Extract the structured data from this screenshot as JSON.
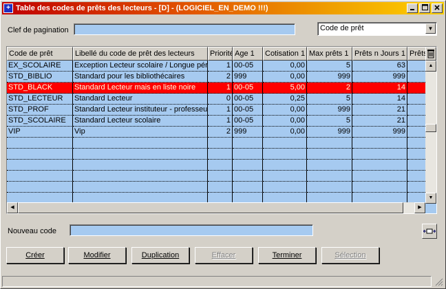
{
  "window": {
    "title": "Table des codes de prêts des lecteurs - [D] - (LOGICIEL_EN_DEMO !!!)"
  },
  "icons": {
    "app": "app-icon",
    "minimize": "minimize-icon",
    "maximize": "maximize-icon",
    "close": "close-icon"
  },
  "pagination": {
    "label": "Clef de pagination",
    "value": "",
    "sort_select": "Code de prêt"
  },
  "table": {
    "columns": [
      "Code de prêt",
      "Libellé du code de prêt des lecteurs",
      "Priorité",
      "Age 1",
      "Cotisation 1",
      "Max prêts 1",
      "Prêts n Jours 1",
      "PrêtsT"
    ],
    "rows": [
      [
        "EX_SCOLAIRE",
        "Exception Lecteur scolaire / Longue pér",
        "1",
        "00-05",
        "0,00",
        "5",
        "63"
      ],
      [
        "STD_BIBLIO",
        "Standard pour les bibliothécaires",
        "2",
        "999",
        "0,00",
        "999",
        "999"
      ],
      [
        "STD_BLACK",
        "Standard Lecteur mais en liste noire",
        "1",
        "00-05",
        "5,00",
        "2",
        "14"
      ],
      [
        "STD_LECTEUR",
        "Standard Lecteur",
        "0",
        "00-05",
        "0,25",
        "5",
        "14"
      ],
      [
        "STD_PROF",
        "Standard Lecteur instituteur - professeur",
        "1",
        "00-05",
        "0,00",
        "999",
        "21"
      ],
      [
        "STD_SCOLAIRE",
        "Standard Lecteur scolaire",
        "1",
        "00-05",
        "0,00",
        "5",
        "21"
      ],
      [
        "VIP",
        "Vip",
        "2",
        "999",
        "0,00",
        "999",
        "999"
      ]
    ],
    "selected_row": 2,
    "empty_rows": 6
  },
  "new_code": {
    "label": "Nouveau code",
    "value": ""
  },
  "buttons": {
    "create": "Créer",
    "modify": "Modifier",
    "duplicate": "Duplication",
    "delete": "Effacer",
    "finish": "Terminer",
    "select": "Sélection"
  },
  "colors": {
    "field_bg": "#a6caf0",
    "selected_row_bg": "#ff0000",
    "selected_row_text": "#ffffe0"
  }
}
